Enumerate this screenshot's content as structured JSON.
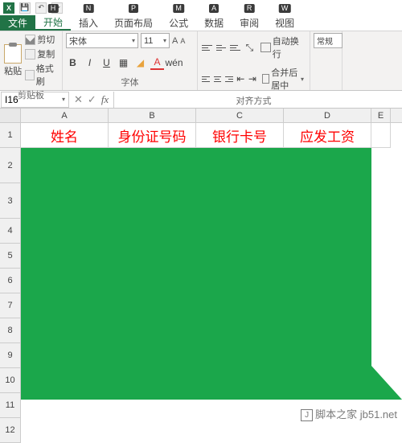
{
  "qat": {
    "save": "💾",
    "undo": "↶",
    "redo": "↷"
  },
  "tabs": {
    "file": "文件",
    "home": "开始",
    "insert": "插入",
    "layout": "页面布局",
    "formulas": "公式",
    "data": "数据",
    "review": "审阅",
    "view": "视图",
    "keys": {
      "home": "H",
      "insert": "N",
      "layout": "P",
      "formulas": "M",
      "data": "A",
      "review": "R",
      "view": "W"
    }
  },
  "ribbon": {
    "clipboard": {
      "paste": "粘贴",
      "cut": "剪切",
      "copy": "复制",
      "format": "格式刷",
      "label": "剪贴板"
    },
    "font": {
      "name": "宋体",
      "size": "11",
      "grow": "A",
      "shrink": "A",
      "bold": "B",
      "italic": "I",
      "underline": "U",
      "label": "字体"
    },
    "align": {
      "wrap": "自动换行",
      "merge": "合并后居中",
      "label": "对齐方式"
    },
    "number": {
      "general": "常规"
    }
  },
  "namebox": "I16",
  "fx_cancel": "✕",
  "fx_accept": "✓",
  "fx_label": "fx",
  "cols": [
    "A",
    "B",
    "C",
    "D",
    "E"
  ],
  "rows": [
    "1",
    "2",
    "3",
    "4",
    "5",
    "6",
    "7",
    "8",
    "9",
    "10",
    "11",
    "12"
  ],
  "headers": {
    "A": "姓名",
    "B": "身份证号码",
    "C": "银行卡号",
    "D": "应发工资"
  },
  "watermark": {
    "site": "脚本之家",
    "url": "jb51.net"
  }
}
